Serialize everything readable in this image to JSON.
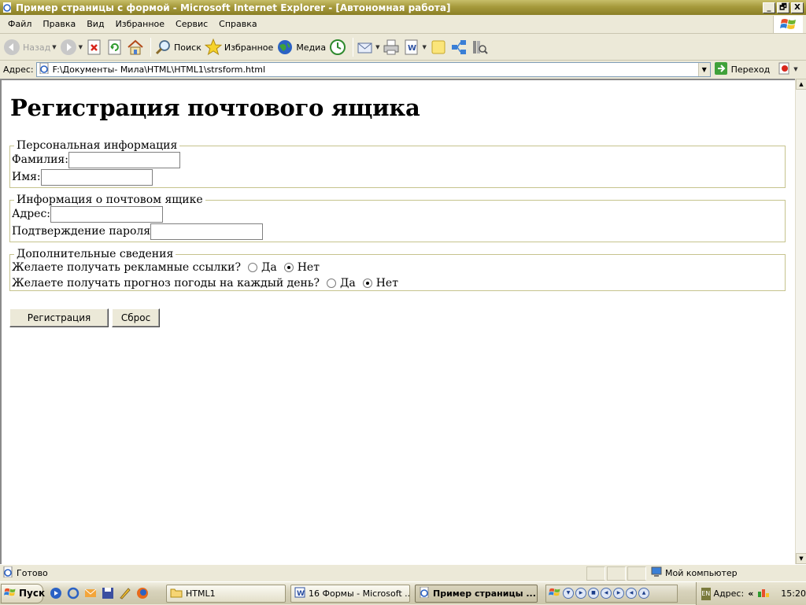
{
  "window": {
    "title": "Пример страницы с формой - Microsoft Internet Explorer - [Автономная работа]",
    "controls": {
      "minimize": "_",
      "maximize": "🗗",
      "close": "X"
    }
  },
  "menu": [
    "Файл",
    "Правка",
    "Вид",
    "Избранное",
    "Сервис",
    "Справка"
  ],
  "toolbar": {
    "back": "Назад",
    "search": "Поиск",
    "favorites": "Избранное",
    "media": "Медиа"
  },
  "address": {
    "label": "Адрес:",
    "url": "F:\\Документы- Мила\\HTML\\HTML1\\strsform.html",
    "go": "Переход"
  },
  "page": {
    "heading": "Регистрация почтового ящика",
    "personal": {
      "legend": "Персональная информация",
      "surname_label": "Фамилия:",
      "surname_value": "",
      "name_label": "Имя:",
      "name_value": ""
    },
    "mailbox": {
      "legend": "Информация о почтовом ящике",
      "address_label": "Адрес:",
      "address_value": "",
      "confirm_label": "Подтверждение пароля",
      "confirm_value": ""
    },
    "extra": {
      "legend": "Дополнительные сведения",
      "ads_question": "Желаете получать рекламные ссылки?",
      "weather_question": "Желаете получать прогноз погоды на каждый день?",
      "yes": "Да",
      "no": "Нет",
      "ads_selected": "Нет",
      "weather_selected": "Нет"
    },
    "register_button": "Регистрация",
    "reset_button": "Сброс"
  },
  "status": {
    "text": "Готово",
    "zone": "Мой компьютер"
  },
  "taskbar": {
    "start": "Пуск",
    "tasks": [
      {
        "label": "HTML1",
        "active": false
      },
      {
        "label": "16 Формы - Microsoft ...",
        "active": false
      },
      {
        "label": "Пример страницы ...",
        "active": true
      }
    ],
    "lang": "EN",
    "address_label": "Адрес:",
    "chevron": "«",
    "clock": "15:20"
  },
  "colors": {
    "titlebar": "#a69a3c",
    "fieldset_border": "#c6c38d",
    "chrome": "#ece9d8"
  },
  "icons": [
    "ie-page-icon",
    "back-icon",
    "forward-icon",
    "stop-icon",
    "refresh-icon",
    "home-icon",
    "search-icon",
    "favorites-icon",
    "media-icon",
    "history-icon",
    "mail-icon",
    "print-icon",
    "edit-icon",
    "discuss-icon",
    "messenger-icon",
    "research-icon",
    "go-icon",
    "windows-logo-icon"
  ]
}
